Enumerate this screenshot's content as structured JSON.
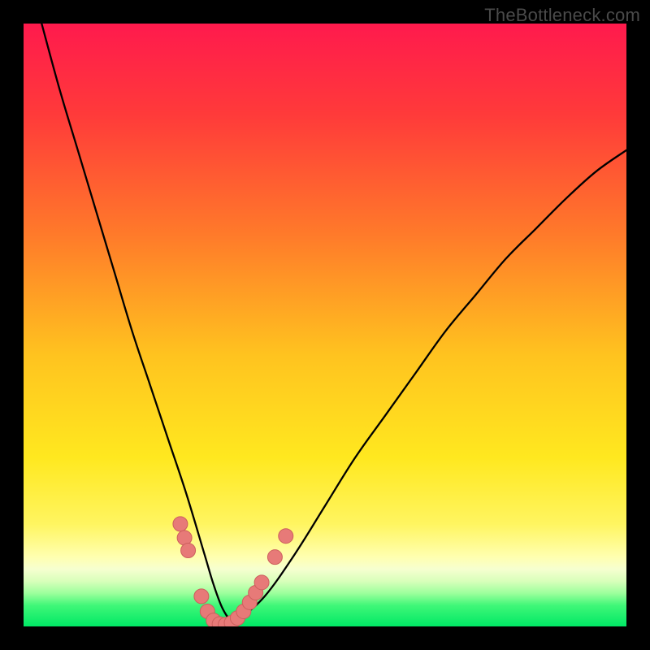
{
  "watermark": "TheBottleneck.com",
  "colors": {
    "black": "#000000",
    "curve": "#000000",
    "marker_fill": "#e77a78",
    "marker_stroke": "#cc5f5d",
    "gradient_stops": [
      {
        "pos": 0.0,
        "color": "#ff1a4d"
      },
      {
        "pos": 0.15,
        "color": "#ff3a3a"
      },
      {
        "pos": 0.35,
        "color": "#ff7a2a"
      },
      {
        "pos": 0.55,
        "color": "#ffc31f"
      },
      {
        "pos": 0.72,
        "color": "#ffe81f"
      },
      {
        "pos": 0.83,
        "color": "#fff560"
      },
      {
        "pos": 0.885,
        "color": "#ffffb0"
      },
      {
        "pos": 0.905,
        "color": "#f6ffd0"
      },
      {
        "pos": 0.925,
        "color": "#d8ffba"
      },
      {
        "pos": 0.945,
        "color": "#9cff9c"
      },
      {
        "pos": 0.965,
        "color": "#40f778"
      },
      {
        "pos": 1.0,
        "color": "#00e865"
      }
    ]
  },
  "chart_data": {
    "type": "line",
    "title": "",
    "xlabel": "",
    "ylabel": "",
    "xlim": [
      0,
      100
    ],
    "ylim": [
      0,
      100
    ],
    "grid": false,
    "legend": false,
    "series": [
      {
        "name": "bottleneck-curve",
        "x": [
          3,
          6,
          9,
          12,
          15,
          18,
          21,
          24,
          27,
          30,
          31.5,
          33,
          34.5,
          36,
          40,
          45,
          50,
          55,
          60,
          65,
          70,
          75,
          80,
          85,
          90,
          95,
          100
        ],
        "y": [
          100,
          89,
          79,
          69,
          59,
          49,
          40,
          31,
          22,
          12,
          7,
          3,
          1,
          1.5,
          5,
          12,
          20,
          28,
          35,
          42,
          49,
          55,
          61,
          66,
          71,
          75.5,
          79
        ]
      }
    ],
    "markers": [
      {
        "x": 26.0,
        "y": 17.0
      },
      {
        "x": 26.7,
        "y": 14.7
      },
      {
        "x": 27.3,
        "y": 12.6
      },
      {
        "x": 29.5,
        "y": 5.0
      },
      {
        "x": 30.5,
        "y": 2.5
      },
      {
        "x": 31.5,
        "y": 1.0
      },
      {
        "x": 32.5,
        "y": 0.4
      },
      {
        "x": 33.5,
        "y": 0.3
      },
      {
        "x": 34.5,
        "y": 0.6
      },
      {
        "x": 35.5,
        "y": 1.4
      },
      {
        "x": 36.5,
        "y": 2.5
      },
      {
        "x": 37.5,
        "y": 4.0
      },
      {
        "x": 38.5,
        "y": 5.6
      },
      {
        "x": 39.5,
        "y": 7.3
      },
      {
        "x": 41.7,
        "y": 11.5
      },
      {
        "x": 43.5,
        "y": 15.0
      }
    ],
    "marker_radius_px": 9
  }
}
